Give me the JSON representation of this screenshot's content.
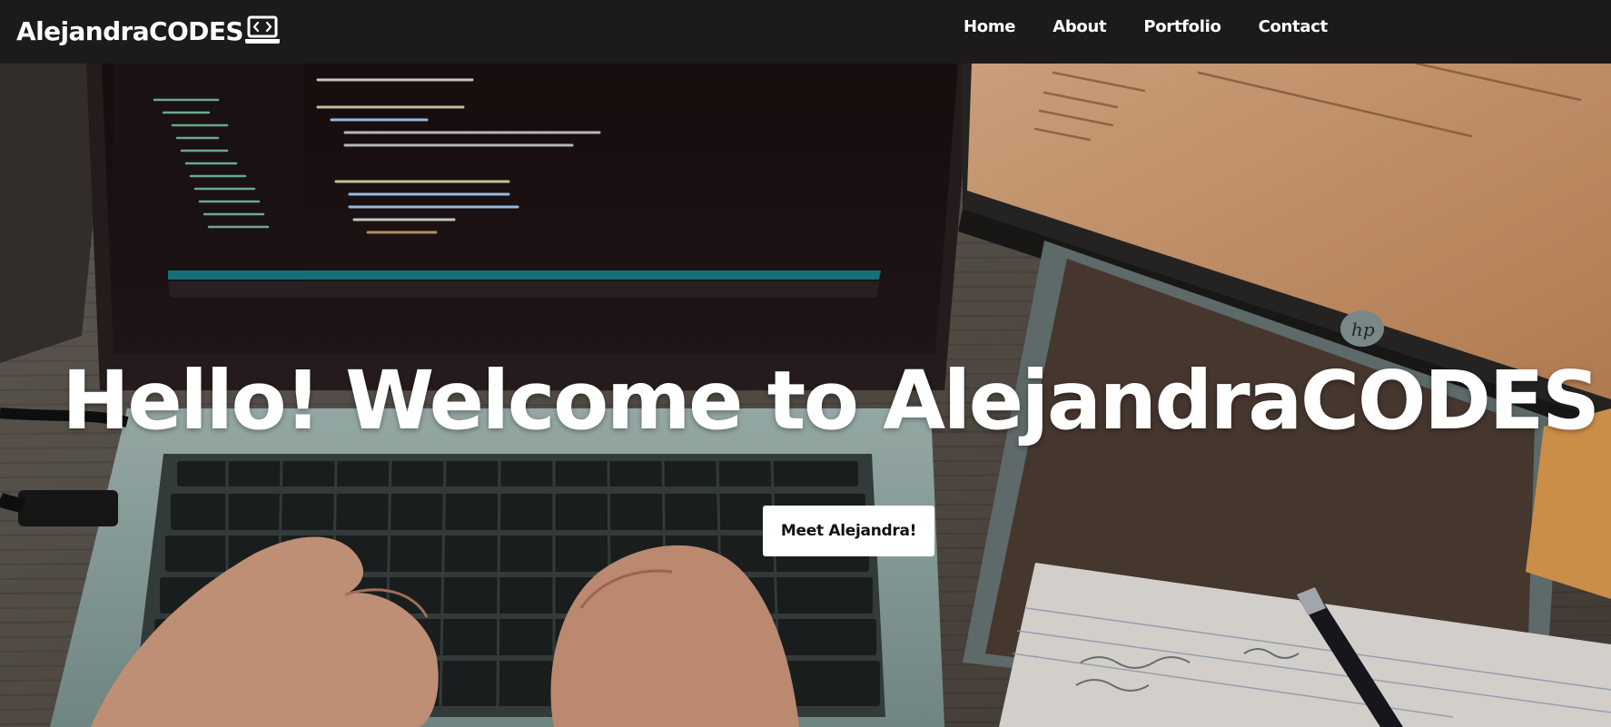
{
  "navbar": {
    "brand": "AlejandraCODES",
    "brand_icon": "laptop-code-icon",
    "links": [
      {
        "label": "Home"
      },
      {
        "label": "About"
      },
      {
        "label": "Portfolio"
      },
      {
        "label": "Contact"
      }
    ]
  },
  "hero": {
    "title": "Hello! Welcome to AlejandraCODES",
    "button_label": "Meet Alejandra!",
    "background": "photo-laptop-coding-desk"
  },
  "colors": {
    "navbar_bg": "#1c1a1b",
    "text": "#ffffff",
    "button_bg": "#ffffff",
    "button_text": "#111111"
  }
}
